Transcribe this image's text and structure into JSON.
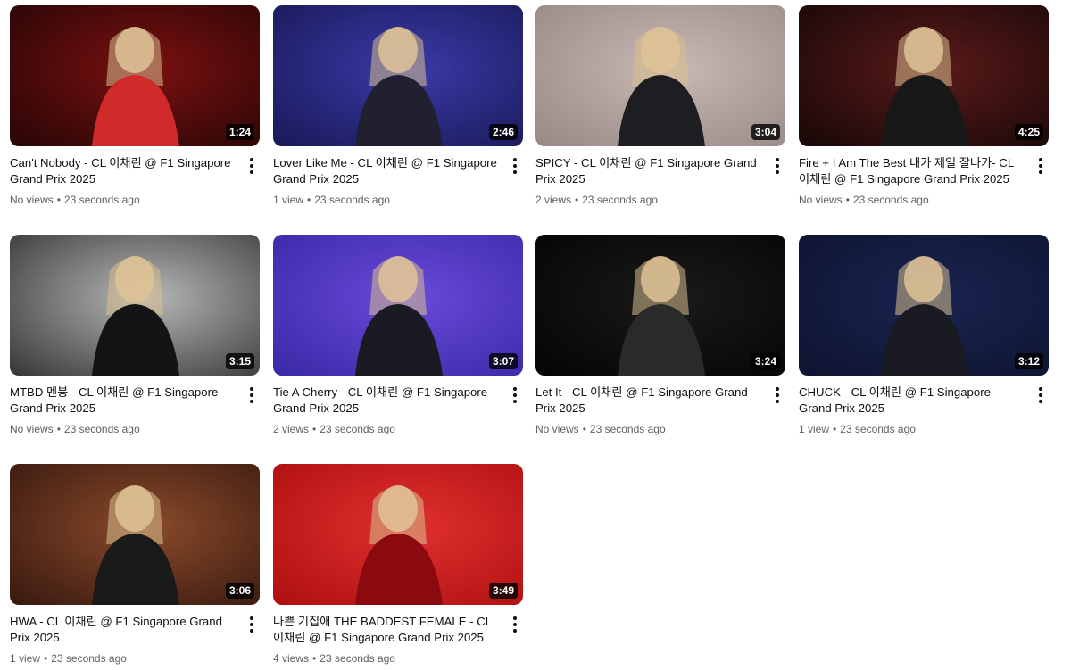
{
  "videos": [
    {
      "title": "Can't Nobody - CL 이채린 @ F1 Singapore Grand Prix 2025",
      "duration": "1:24",
      "views": "No views",
      "age": "23 seconds ago",
      "bg": [
        "#2a0606",
        "#7a1010"
      ],
      "fig": "#d02a2a"
    },
    {
      "title": "Lover Like Me - CL 이채린 @ F1 Singapore Grand Prix 2025",
      "duration": "2:46",
      "views": "1 view",
      "age": "23 seconds ago",
      "bg": [
        "#1a1a5a",
        "#3a3aa8"
      ],
      "fig": "#202030"
    },
    {
      "title": "SPICY - CL 이채린 @ F1 Singapore Grand Prix 2025",
      "duration": "3:04",
      "views": "2 views",
      "age": "23 seconds ago",
      "bg": [
        "#9a8a88",
        "#c9b9b4"
      ],
      "fig": "#1e1e22"
    },
    {
      "title": "Fire + I Am The Best 내가 제일 잘나가- CL 이채린 @ F1 Singapore Grand Prix 2025",
      "duration": "4:25",
      "views": "No views",
      "age": "23 seconds ago",
      "bg": [
        "#1a0808",
        "#5a1a1a"
      ],
      "fig": "#181818"
    },
    {
      "title": "MTBD 멘붕 - CL 이채린 @ F1 Singapore Grand Prix 2025",
      "duration": "3:15",
      "views": "No views",
      "age": "23 seconds ago",
      "bg": [
        "#3a3a3a",
        "#b8b8b8"
      ],
      "fig": "#141414"
    },
    {
      "title": "Tie A Cherry - CL 이채린 @ F1 Singapore Grand Prix 2025",
      "duration": "3:07",
      "views": "2 views",
      "age": "23 seconds ago",
      "bg": [
        "#3a2aa8",
        "#6a4ad8"
      ],
      "fig": "#1a1a22"
    },
    {
      "title": "Let It - CL 이채린 @ F1 Singapore Grand Prix 2025",
      "duration": "3:24",
      "views": "No views",
      "age": "23 seconds ago",
      "bg": [
        "#050505",
        "#1a1a1a"
      ],
      "fig": "#2a2a2a"
    },
    {
      "title": "CHUCK - CL 이채린 @ F1 Singapore Grand Prix 2025",
      "duration": "3:12",
      "views": "1 view",
      "age": "23 seconds ago",
      "bg": [
        "#0e1430",
        "#1a2450"
      ],
      "fig": "#1a1a22"
    },
    {
      "title": "HWA - CL 이채린 @ F1 Singapore Grand Prix 2025",
      "duration": "3:06",
      "views": "1 view",
      "age": "23 seconds ago",
      "bg": [
        "#3a1a10",
        "#8a4a2a"
      ],
      "fig": "#1a1a1a"
    },
    {
      "title": "나쁜 기집애 THE BADDEST FEMALE - CL 이채린 @ F1 Singapore Grand Prix 2025",
      "duration": "3:49",
      "views": "4 views",
      "age": "23 seconds ago",
      "bg": [
        "#b01010",
        "#e03030"
      ],
      "fig": "#8a0a10"
    }
  ],
  "more_icon": "vertical-ellipsis-icon",
  "separator": "•"
}
